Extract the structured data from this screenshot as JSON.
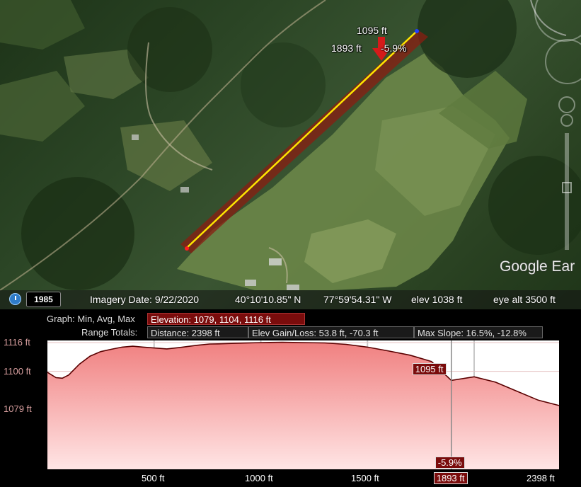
{
  "map": {
    "measure": {
      "distance_label": "1095 ft",
      "left_label": "1893 ft",
      "slope_label": "-5.9%"
    },
    "watermark": "Google Ear"
  },
  "status": {
    "year": "1985",
    "imagery_date": "Imagery Date: 9/22/2020",
    "lat": "40°10'10.85\" N",
    "lon": "77°59'54.31\" W",
    "elev": "elev  1038 ft",
    "eye_alt": "eye alt   3500 ft"
  },
  "graph": {
    "graph_label": "Graph: Min, Avg, Max",
    "elevation_box": "Elevation: 1079, 1104, 1116 ft",
    "range_label": "Range Totals:",
    "distance_box": "Distance: 2398 ft",
    "gain_loss_box": "Elev Gain/Loss: 53.8 ft, -70.3 ft",
    "max_slope_box": "Max Slope: 16.5%, -12.8%",
    "cursor_elev_tag": "1095 ft",
    "cursor_slope_tag": "-5.9%",
    "cursor_dist_tag": "1893 ft"
  },
  "chart_data": {
    "type": "area",
    "title": "",
    "xlabel": "",
    "ylabel": "",
    "ylim": [
      1079,
      1116
    ],
    "xlim": [
      0,
      2398
    ],
    "y_ticks": [
      "1116 ft",
      "1100 ft",
      "1079 ft"
    ],
    "x_ticks": [
      "500 ft",
      "1000 ft",
      "1500 ft",
      "2398 ft"
    ],
    "grid": true,
    "series": [
      {
        "x": [
          0,
          40,
          70,
          100,
          150,
          200,
          250,
          300,
          350,
          400,
          450,
          500,
          560,
          620,
          700,
          760,
          800,
          900,
          1000,
          1100,
          1200,
          1300,
          1400,
          1500,
          1600,
          1700,
          1800,
          1893,
          2000,
          2100,
          2200,
          2300,
          2398
        ],
        "y": [
          1099.5,
          1096.5,
          1096.2,
          1098,
          1104,
          1108.5,
          1111,
          1112.3,
          1113.5,
          1114,
          1113.5,
          1113,
          1112.5,
          1113.3,
          1114.5,
          1115.2,
          1115.3,
          1115.7,
          1116,
          1116.2,
          1116,
          1115.8,
          1115,
          1113.5,
          1111.3,
          1109,
          1105.5,
          1095,
          1097,
          1094,
          1089,
          1084,
          1081
        ]
      }
    ],
    "cursor": {
      "x": 1893,
      "y": 1095,
      "slope": "-5.9%"
    }
  },
  "colors": {
    "track": "#ffe600",
    "track_band": "#8a1d12",
    "fill_top": "#f08080",
    "fill_bottom": "#ffe5e5",
    "line": "#5a0000",
    "tag_bg": "#7a0c0c"
  }
}
